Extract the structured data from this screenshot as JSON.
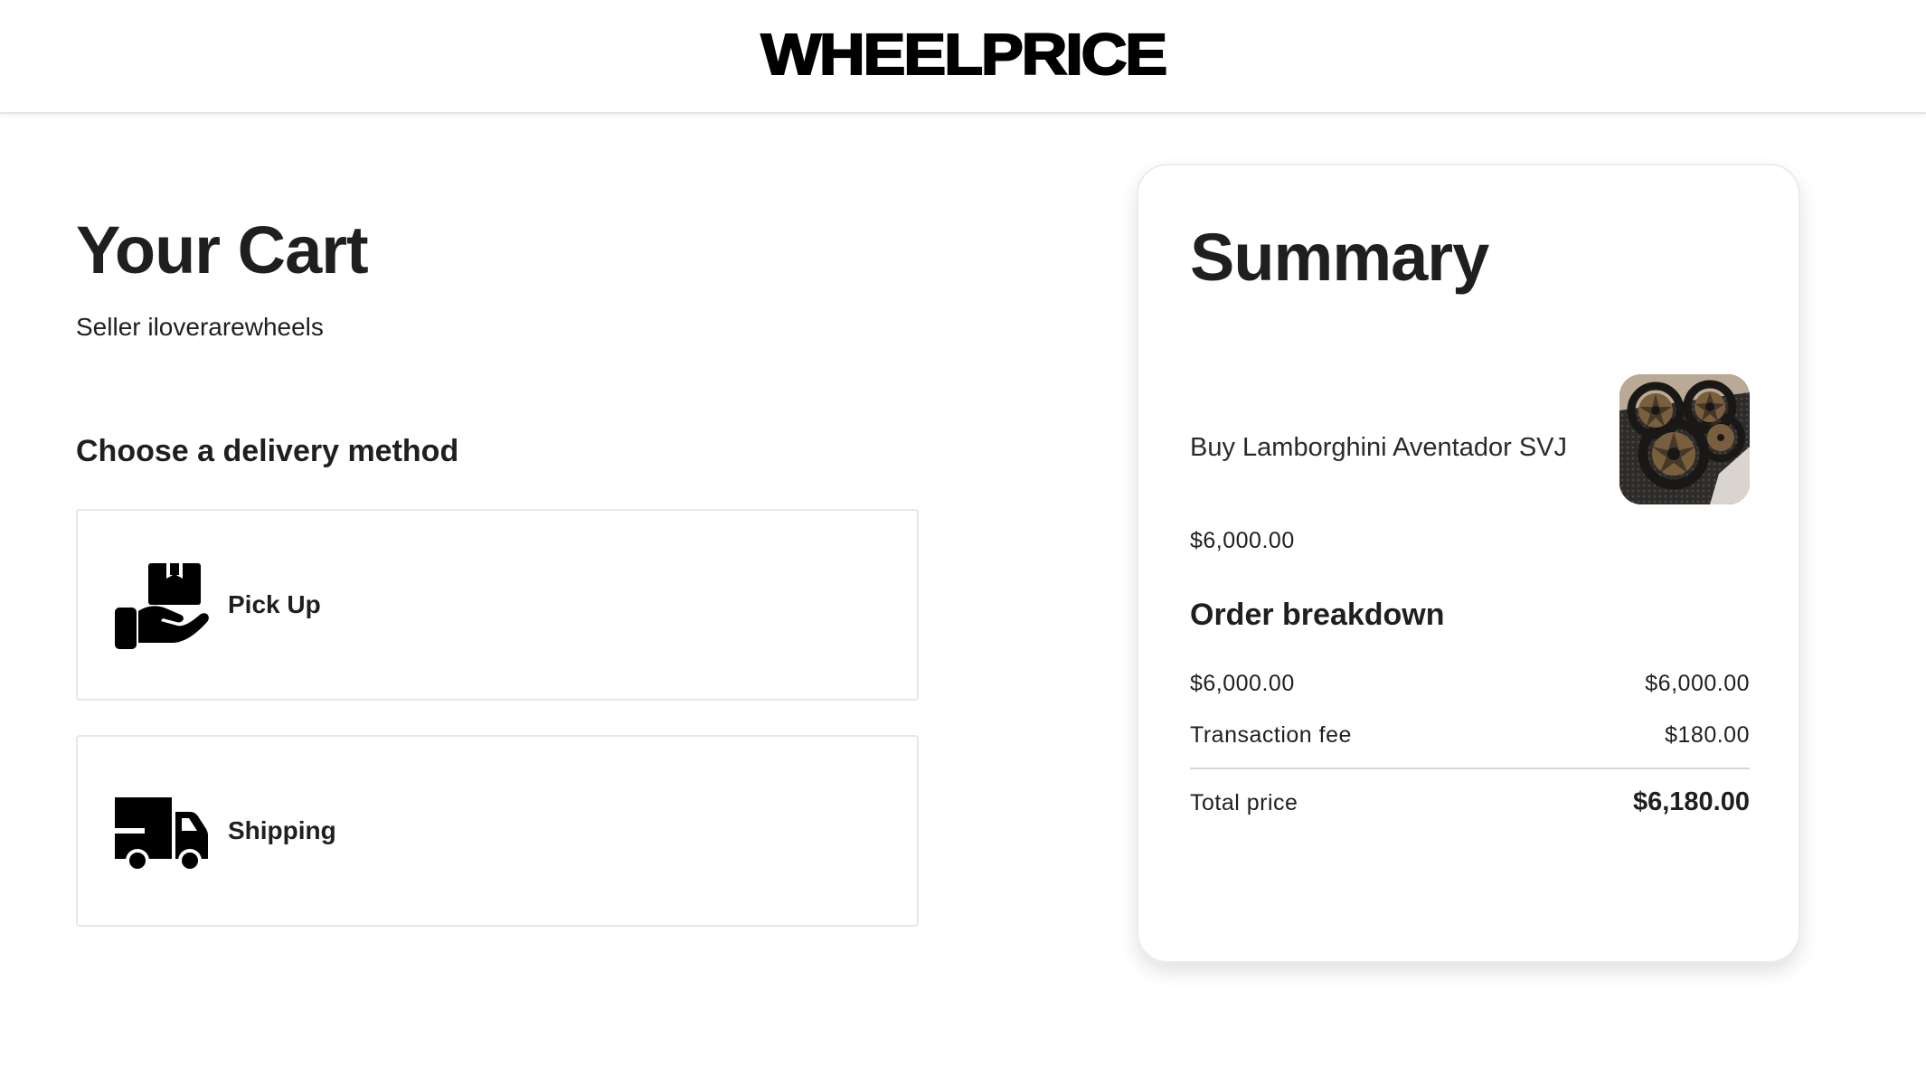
{
  "header": {
    "logo_text": "WHEELPRICE"
  },
  "cart": {
    "title": "Your Cart",
    "seller_line": "Seller iloverarewheels"
  },
  "delivery": {
    "heading": "Choose a delivery method",
    "options": [
      {
        "label": "Pick Up",
        "icon": "hand-holding-box-icon"
      },
      {
        "label": "Shipping",
        "icon": "delivery-truck-icon"
      }
    ]
  },
  "summary": {
    "title": "Summary",
    "product_name": "Buy Lamborghini Aventador SVJ",
    "product_image_icon": "wheels-photo",
    "product_price": "$6,000.00",
    "breakdown_heading": "Order breakdown",
    "rows": [
      {
        "label": "$6,000.00",
        "value": "$6,000.00"
      },
      {
        "label": "Transaction fee",
        "value": "$180.00"
      }
    ],
    "total": {
      "label": "Total price",
      "value": "$6,180.00"
    }
  },
  "colors": {
    "text": "#1f1f1f",
    "border": "#e6e6e6",
    "logo": "#000000",
    "background": "#ffffff"
  }
}
